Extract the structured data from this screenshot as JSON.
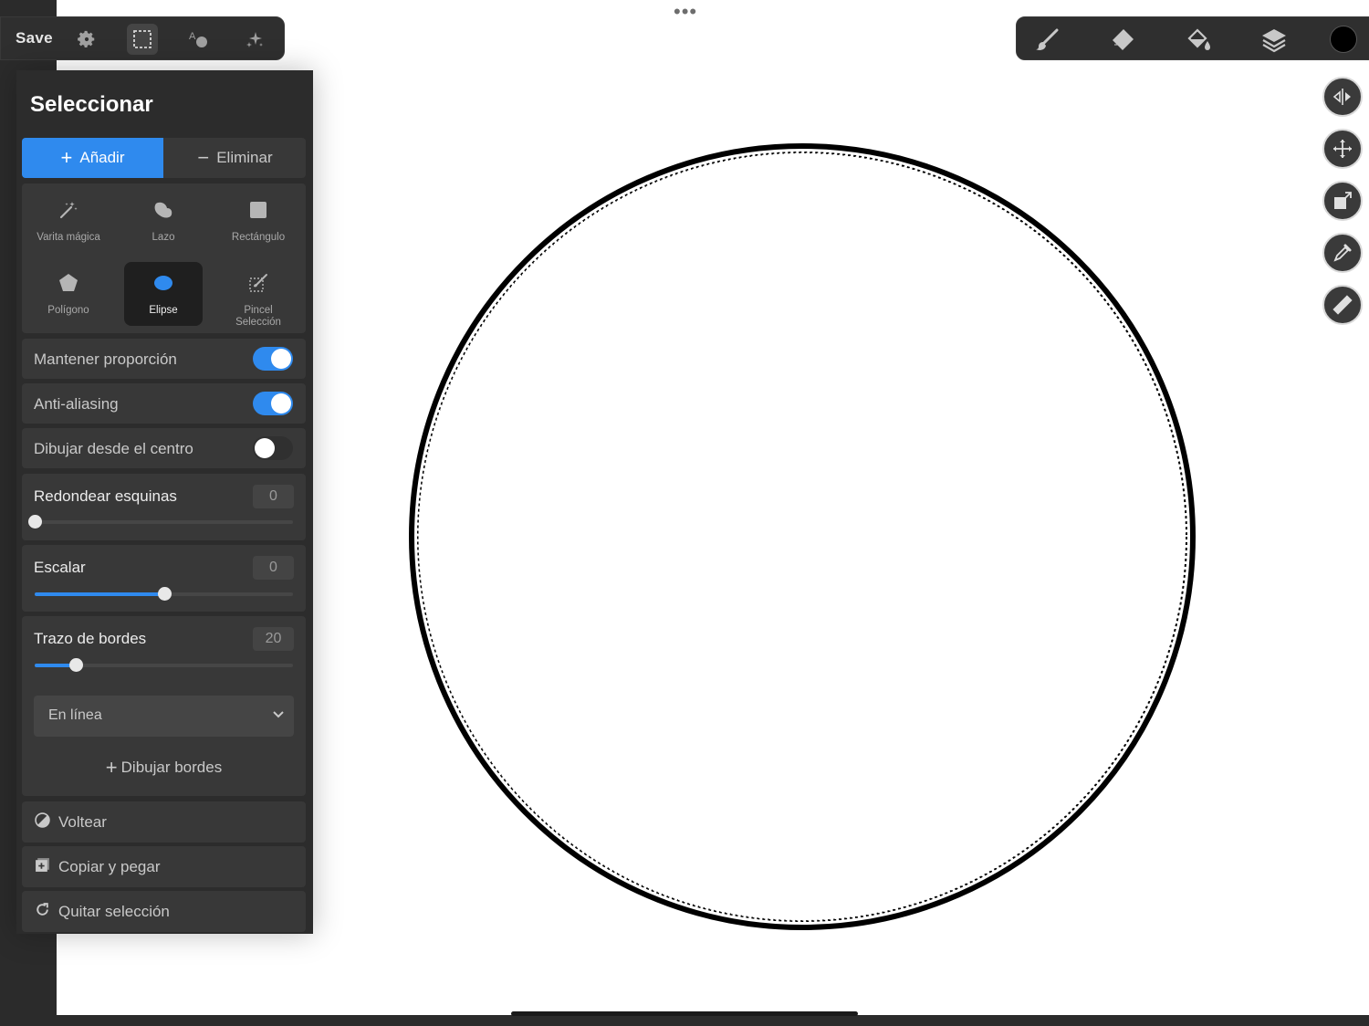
{
  "top_toolbar": {
    "save_label": "Save",
    "icons": [
      "gear-icon",
      "selection-icon",
      "shapes-text-icon",
      "sparkle-icon"
    ]
  },
  "right_toolbar": {
    "icons": [
      "brush-icon",
      "eraser-icon",
      "fill-bucket-icon",
      "layers-icon"
    ],
    "current_color": "#000000"
  },
  "side_tools": [
    "mirror-icon",
    "move-icon",
    "transform-icon",
    "eyedropper-icon",
    "ruler-icon"
  ],
  "panel": {
    "title": "Seleccionar",
    "mode": {
      "add_label": "Añadir",
      "remove_label": "Eliminar",
      "active": "add"
    },
    "tools": {
      "magic_wand": "Varita mágica",
      "lasso": "Lazo",
      "rectangle": "Rectángulo",
      "polygon": "Polígono",
      "ellipse": "Elipse",
      "brush_line1": "Pincel",
      "brush_line2": "Selección",
      "active": "ellipse"
    },
    "toggles": {
      "keep_ratio": {
        "label": "Mantener proporción",
        "on": true
      },
      "anti_aliasing": {
        "label": "Anti-aliasing",
        "on": true
      },
      "from_center": {
        "label": "Dibujar desde el centro",
        "on": false
      }
    },
    "sliders": {
      "round_corners": {
        "label": "Redondear esquinas",
        "value": "0",
        "level": 0.0
      },
      "scale": {
        "label": "Escalar",
        "value": "0",
        "level": 0.5
      },
      "stroke": {
        "label": "Trazo de bordes",
        "value": "20",
        "level": 0.16
      }
    },
    "stroke_type": "En línea",
    "draw_borders_label": "Dibujar bordes",
    "actions": {
      "flip": "Voltear",
      "copy_paste": "Copiar y pegar",
      "clear_selection": "Quitar selección"
    }
  },
  "accent_color": "#2f8aee"
}
